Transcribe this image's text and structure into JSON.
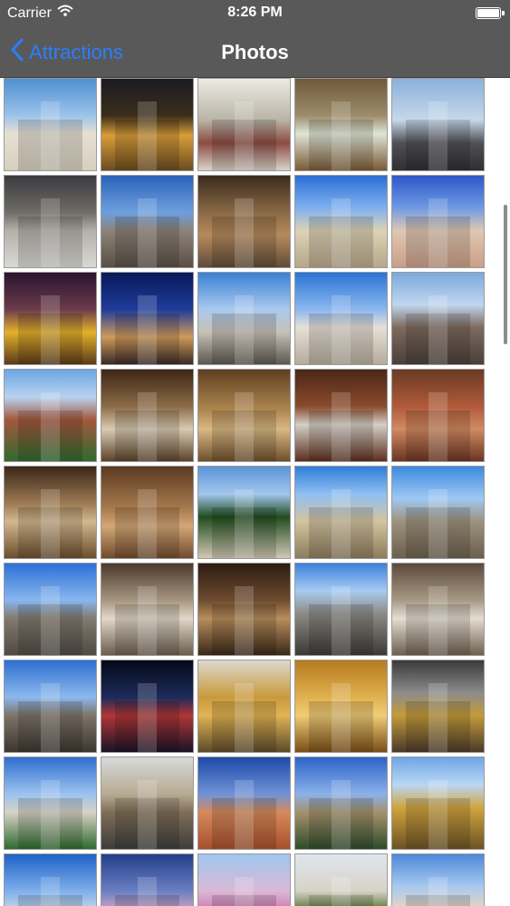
{
  "status_bar": {
    "carrier": "Carrier",
    "time": "8:26 PM"
  },
  "nav": {
    "back_label": "Attractions",
    "title": "Photos"
  },
  "photos": [
    {
      "bg": "linear-gradient(180deg,#4f8fd2 0%,#9cc3ea 40%,#e7e0d2 60%,#d6cfbf 100%)"
    },
    {
      "bg": "linear-gradient(180deg,#1b1b24 0%,#3b2d1a 40%,#d89d39 62%,#6a4b20 100%)"
    },
    {
      "bg": "linear-gradient(180deg,#ecebe5 0%,#b9b4a6 45%,#8c4b43 70%,#d8d4c9 100%)"
    },
    {
      "bg": "linear-gradient(180deg,#6e5a3b 0%,#9c8c6a 40%,#dfe5d6 60%,#7a5a35 100%)"
    },
    {
      "bg": "linear-gradient(180deg,#8ab1da 0%,#c6d8eb 45%,#505056 70%,#2e2e33 100%)"
    },
    {
      "bg": "linear-gradient(180deg,#3b3b40 0%,#6f6c67 40%,#b4b0aa 60%,#d9d8d4 100%)"
    },
    {
      "bg": "linear-gradient(180deg,#2c62ba 0%,#6d9fdd 40%,#8d8378 60%,#5a4f45 100%)"
    },
    {
      "bg": "linear-gradient(180deg,#3a2a1c 0%,#8a6a46 40%,#b58a5c 65%,#5f4b39 100%)"
    },
    {
      "bg": "linear-gradient(180deg,#2a6fd5 0%,#7fb0ef 35%,#ddd2b5 60%,#b7a789 100%)"
    },
    {
      "bg": "linear-gradient(180deg,#2d57c8 0%,#6f9ae4 35%,#e0c7b2 60%,#c99f87 100%)"
    },
    {
      "bg": "linear-gradient(180deg,#2b1430 0%,#6a3b4a 40%,#e4b12b 65%,#5b3a1a 100%)"
    },
    {
      "bg": "linear-gradient(180deg,#081a5a 0%,#1f3c9b 40%,#cf9a5a 70%,#3a2a28 100%)"
    },
    {
      "bg": "linear-gradient(180deg,#3b80d3 0%,#a9c9ef 40%,#c7c1b6 65%,#5c5750 100%)"
    },
    {
      "bg": "linear-gradient(180deg,#2a74d6 0%,#8bb7ee 40%,#e7e0d6 60%,#b5ab9a 100%)"
    },
    {
      "bg": "linear-gradient(180deg,#7ba9db 0%,#c0d6ee 35%,#7d6a5d 60%,#4a3f39 100%)"
    },
    {
      "bg": "linear-gradient(180deg,#6ca6e4 0%,#b9d2ef 30%,#a4573c 55%,#2f6b2f 100%)"
    },
    {
      "bg": "linear-gradient(180deg,#3d2716 0%,#8b6a46 40%,#d8cbb3 65%,#5b4228 100%)"
    },
    {
      "bg": "linear-gradient(180deg,#5e3f21 0%,#b08850 45%,#d8b885 65%,#6e4f2a 100%)"
    },
    {
      "bg": "linear-gradient(180deg,#4a2717 0%,#8a4a2c 40%,#d4cfc6 60%,#5b2f1d 100%)"
    },
    {
      "bg": "linear-gradient(180deg,#6a3a24 0%,#b05a3a 40%,#d18a62 65%,#6a3422 100%)"
    },
    {
      "bg": "linear-gradient(180deg,#3b2719 0%,#9c7a53 40%,#d3b890 60%,#6b4c2c 100%)"
    },
    {
      "bg": "linear-gradient(180deg,#5a3a22 0%,#a6794d 45%,#d3a776 65%,#6f4a2c 100%)"
    },
    {
      "bg": "linear-gradient(180deg,#5a94d8 0%,#a3c6ec 30%,#214d1f 55%,#d2c8b4 100%)"
    },
    {
      "bg": "linear-gradient(180deg,#2f7ed9 0%,#90bff2 30%,#d3c4a0 60%,#8c7b5c 100%)"
    },
    {
      "bg": "linear-gradient(180deg,#3b8ae0 0%,#9fc8f3 35%,#9d927d 60%,#6b5f4d 100%)"
    },
    {
      "bg": "linear-gradient(180deg,#2c70d5 0%,#88b6ee 40%,#827a6e 60%,#4f4a43 100%)"
    },
    {
      "bg": "linear-gradient(180deg,#4b3a2d 0%,#a69680 40%,#e1d8c9 60%,#6b5d4d 100%)"
    },
    {
      "bg": "linear-gradient(180deg,#2d1b12 0%,#6d4b2e 40%,#b88e5c 60%,#3a2818 100%)"
    },
    {
      "bg": "linear-gradient(180deg,#3a82dc 0%,#a7cbf1 30%,#8d8a84 55%,#3b3a36 100%)"
    },
    {
      "bg": "linear-gradient(180deg,#5b4a3a 0%,#a89985 40%,#e4ddd2 60%,#6e5f4e 100%)"
    },
    {
      "bg": "linear-gradient(180deg,#2c6fd0 0%,#8db8ee 40%,#7e7468 60%,#3c3630 100%)"
    },
    {
      "bg": "linear-gradient(180deg,#050a18 0%,#1c2a5a 40%,#b03636 60%,#1a1326 100%)"
    },
    {
      "bg": "linear-gradient(180deg,#ded8cf 0%,#c89a3c 40%,#e1b354 60%,#5c4a2a 100%)"
    },
    {
      "bg": "linear-gradient(180deg,#b57b1f 0%,#e0b14f 40%,#f0cc77 60%,#7a4e17 100%)"
    },
    {
      "bg": "linear-gradient(180deg,#3a3a3a 0%,#8b8b8b 35%,#c49b3a 60%,#4a3a2a 100%)"
    },
    {
      "bg": "linear-gradient(180deg,#2f6fd0 0%,#9cc2ef 40%,#d7d2c6 60%,#2f6a2e 100%)"
    },
    {
      "bg": "linear-gradient(180deg,#d7d9da 0%,#b7ab93 40%,#7f6e58 60%,#3d3d3a 100%)"
    },
    {
      "bg": "linear-gradient(180deg,#1e49a8 0%,#6f93d6 40%,#d78a5a 60%,#a64f2d 100%)"
    },
    {
      "bg": "linear-gradient(180deg,#2b63c8 0%,#8cb1ea 40%,#a4926c 60%,#2e4b2a 100%)"
    },
    {
      "bg": "linear-gradient(180deg,#6ea6e6 0%,#b9d7f3 30%,#d1a43f 55%,#6b5325 100%)"
    },
    {
      "bg": "linear-gradient(180deg,#1f62c7 0%,#7fafec 40%,#e8e7e2 70%,#7a7a72 100%)"
    },
    {
      "bg": "linear-gradient(180deg,#233e8a 0%,#6a7fc2 40%,#c9a2c4 60%,#2f2a2f 100%)"
    },
    {
      "bg": "linear-gradient(180deg,#9fc6ee 0%,#d9b9d6 40%,#d07cb5 60%,#3e5a2a 100%)"
    },
    {
      "bg": "linear-gradient(180deg,#dfe6ee 0%,#d7d3c7 40%,#5c7a3a 60%,#2c3a22 100%)"
    },
    {
      "bg": "linear-gradient(180deg,#4c88d9 0%,#a8c9ef 35%,#e7d6c2 60%,#8a7864 100%)"
    }
  ]
}
